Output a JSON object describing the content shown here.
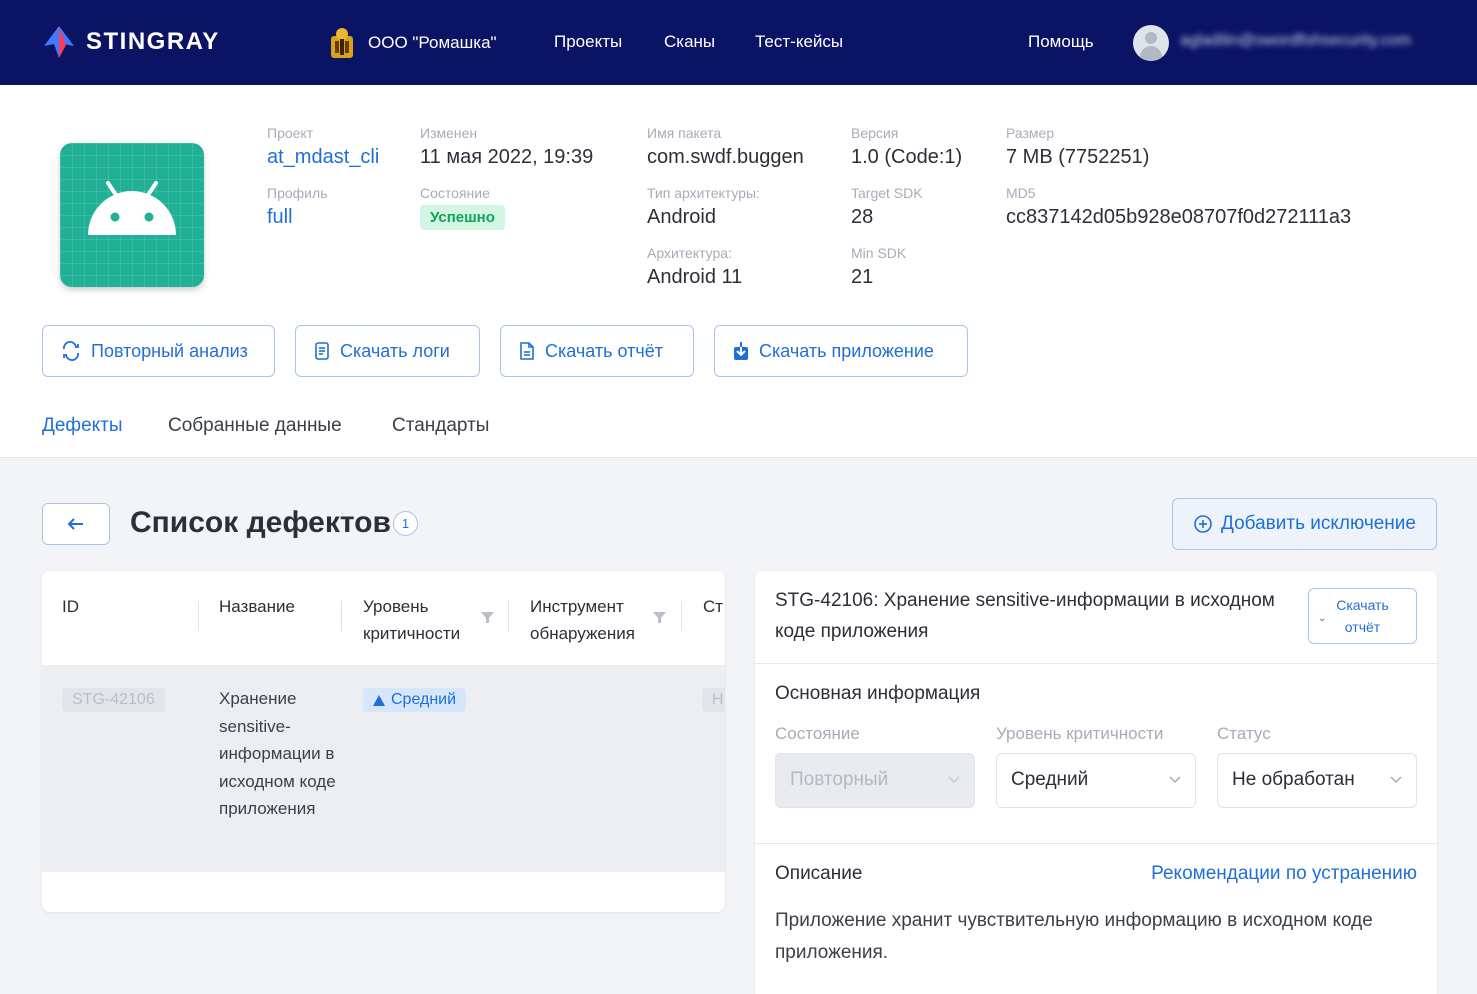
{
  "header": {
    "logo_text": "STINGRAY",
    "org": "ООО \"Ромашка\"",
    "nav": [
      "Проекты",
      "Сканы",
      "Тест-кейсы"
    ],
    "help": "Помощь",
    "user_email": "agladilin@swordfishsecurity.com"
  },
  "app": {
    "project_label": "Проект",
    "project_value": "at_mdast_cli",
    "profile_label": "Профиль",
    "profile_value": "full",
    "changed_label": "Изменен",
    "changed_value": "11 мая 2022, 19:39",
    "state_label": "Состояние",
    "state_value": "Успешно",
    "package_label": "Имя пакета",
    "package_value": "com.swdf.buggen",
    "arch_type_label": "Тип архитектуры:",
    "arch_type_value": "Android",
    "arch_label": "Архитектура:",
    "arch_value": "Android 11",
    "version_label": "Версия",
    "version_value": "1.0 (Code:1)",
    "target_sdk_label": "Target SDK",
    "target_sdk_value": "28",
    "min_sdk_label": "Min SDK",
    "min_sdk_value": "21",
    "size_label": "Размер",
    "size_value": "7 MB (7752251)",
    "md5_label": "MD5",
    "md5_value": "cc837142d05b928e08707f0d272111a3"
  },
  "actions": {
    "reanalyze": "Повторный анализ",
    "download_logs": "Скачать логи",
    "download_report": "Скачать отчёт",
    "download_app": "Скачать приложение"
  },
  "tabs": [
    "Дефекты",
    "Собранные данные",
    "Стандарты"
  ],
  "defects": {
    "title": "Список дефектов",
    "count": "1",
    "add_exception": "Добавить исключение",
    "columns": [
      "ID",
      "Название",
      "Уровень критичности",
      "Инструмент обнаружения",
      "Ст"
    ],
    "rows": [
      {
        "id": "STG-42106",
        "name": "Хранение sensitive-информации в исходном коде приложения",
        "severity": "Средний",
        "status_cut": "Н"
      }
    ]
  },
  "detail": {
    "title": "STG-42106: Хранение sensitive-информации в исходном коде приложения",
    "download_line1": "Скачать",
    "download_line2": "отчёт",
    "main_info": "Основная информация",
    "state_label": "Состояние",
    "state_value": "Повторный",
    "severity_label": "Уровень критичности",
    "severity_value": "Средний",
    "status_label": "Статус",
    "status_value": "Не обработан",
    "description_label": "Описание",
    "recommendations": "Рекомендации по устранению",
    "description_text": "Приложение хранит чувствительную информацию в исходном коде приложения."
  },
  "colors": {
    "header_bg": "#0b1464",
    "accent": "#1f6fd8",
    "success": "#12a35a",
    "app_icon": "#1fb096"
  }
}
